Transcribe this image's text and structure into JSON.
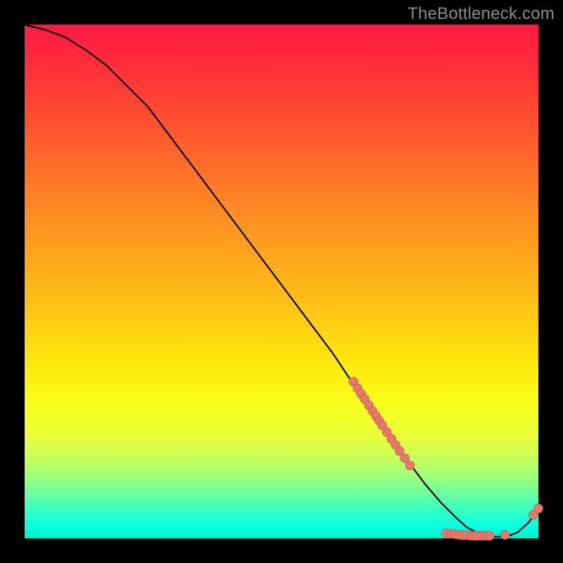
{
  "watermark": "TheBottleneck.com",
  "colors": {
    "background": "#000000",
    "line": "#000000",
    "dot_fill": "#e8776c",
    "dot_stroke": "#b55a52"
  },
  "chart_data": {
    "type": "line",
    "title": "",
    "xlabel": "",
    "ylabel": "",
    "xlim": [
      0,
      100
    ],
    "ylim": [
      0,
      100
    ],
    "series": [
      {
        "name": "bottleneck-curve",
        "x": [
          0,
          4,
          8,
          12,
          16,
          20,
          24,
          30,
          36,
          42,
          48,
          54,
          60,
          64,
          68,
          72,
          75,
          78,
          81,
          84,
          86,
          88,
          90,
          92,
          94,
          96,
          98,
          100
        ],
        "y": [
          100,
          99,
          97.5,
          95,
          92,
          88,
          84,
          76,
          68,
          60,
          52,
          44,
          36,
          30,
          24.5,
          19,
          14.5,
          10.5,
          7,
          4,
          2.2,
          1.1,
          0.5,
          0.3,
          0.4,
          1.2,
          3,
          5.5
        ]
      }
    ],
    "dot_clusters": [
      {
        "name": "diagonal-cluster",
        "points": [
          {
            "x": 64.0,
            "y": 30.5
          },
          {
            "x": 64.8,
            "y": 29.2
          },
          {
            "x": 65.5,
            "y": 28.1
          },
          {
            "x": 66.2,
            "y": 27.1
          },
          {
            "x": 67.0,
            "y": 25.9
          },
          {
            "x": 67.7,
            "y": 24.8
          },
          {
            "x": 68.4,
            "y": 23.8
          },
          {
            "x": 69.0,
            "y": 22.9
          },
          {
            "x": 69.6,
            "y": 22.0
          },
          {
            "x": 70.5,
            "y": 20.7
          },
          {
            "x": 71.4,
            "y": 19.4
          },
          {
            "x": 72.2,
            "y": 18.2
          },
          {
            "x": 73.0,
            "y": 17.0
          },
          {
            "x": 74.0,
            "y": 15.6
          },
          {
            "x": 75.0,
            "y": 14.2
          }
        ]
      },
      {
        "name": "bottom-cluster",
        "points": [
          {
            "x": 82.0,
            "y": 1.0
          },
          {
            "x": 83.0,
            "y": 0.9
          },
          {
            "x": 83.8,
            "y": 0.8
          },
          {
            "x": 84.5,
            "y": 0.7
          },
          {
            "x": 85.2,
            "y": 0.6
          },
          {
            "x": 86.0,
            "y": 0.6
          },
          {
            "x": 86.8,
            "y": 0.5
          },
          {
            "x": 87.5,
            "y": 0.5
          },
          {
            "x": 88.2,
            "y": 0.5
          },
          {
            "x": 89.0,
            "y": 0.5
          },
          {
            "x": 89.8,
            "y": 0.5
          },
          {
            "x": 90.5,
            "y": 0.5
          },
          {
            "x": 93.5,
            "y": 0.7
          }
        ]
      },
      {
        "name": "tail-cluster",
        "points": [
          {
            "x": 99.0,
            "y": 4.6
          },
          {
            "x": 100.0,
            "y": 5.8
          }
        ]
      }
    ]
  }
}
